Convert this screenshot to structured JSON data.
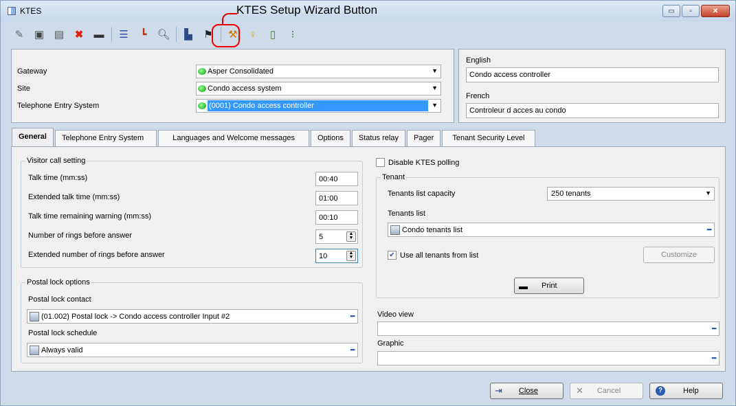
{
  "window": {
    "title": "KTES",
    "annotation": "KTES Setup Wizard Button",
    "buttons": [
      "▭",
      "▫",
      "✕"
    ]
  },
  "toolbar": {
    "icons": [
      "new-icon",
      "save-icon",
      "save-as-icon",
      "delete-icon",
      "print-icon",
      "list-icon",
      "link-icon",
      "search-icon",
      "setup-wizard-icon",
      "flag-icon",
      "tools-icon",
      "bulb-icon",
      "reader-icon",
      "traffic-light-icon"
    ]
  },
  "header": {
    "gateway_label": "Gateway",
    "gateway_value": "Asper Consolidated",
    "site_label": "Site",
    "site_value": "Condo access system",
    "tes_label": "Telephone Entry System",
    "tes_value": "(0001) Condo access controller",
    "english_label": "English",
    "english_value": "Condo access controller",
    "french_label": "French",
    "french_value": "Controleur d acces au condo"
  },
  "tabs": [
    "General",
    "Telephone Entry System",
    "Languages and Welcome messages",
    "Options",
    "Status relay",
    "Pager",
    "Tenant Security Level"
  ],
  "visitor_call": {
    "title": "Visitor call setting",
    "talk_time_label": "Talk time (mm:ss)",
    "talk_time_value": "00:40",
    "extended_talk_label": "Extended talk time (mm:ss)",
    "extended_talk_value": "01:00",
    "remaining_label": "Talk time remaining warning (mm:ss)",
    "remaining_value": "00:10",
    "rings_label": "Number of rings before answer",
    "rings_value": "5",
    "ext_rings_label": "Extended number of rings before answer",
    "ext_rings_value": "10"
  },
  "postal": {
    "title": "Postal lock options",
    "contact_label": "Postal lock contact",
    "contact_value": "(01.002) Postal lock -> Condo access controller Input #2",
    "schedule_label": "Postal lock schedule",
    "schedule_value": "Always valid"
  },
  "right": {
    "disable_polling": "Disable KTES polling",
    "tenant_title": "Tenant",
    "capacity_label": "Tenants list capacity",
    "capacity_value": "250 tenants",
    "list_label": "Tenants list",
    "list_value": "Condo tenants list",
    "use_all_label": "Use all tenants from list",
    "customize_label": "Customize",
    "print_label": "Print",
    "video_label": "Video view",
    "graphic_label": "Graphic"
  },
  "footer": {
    "close": "Close",
    "cancel": "Cancel",
    "help": "Help"
  }
}
